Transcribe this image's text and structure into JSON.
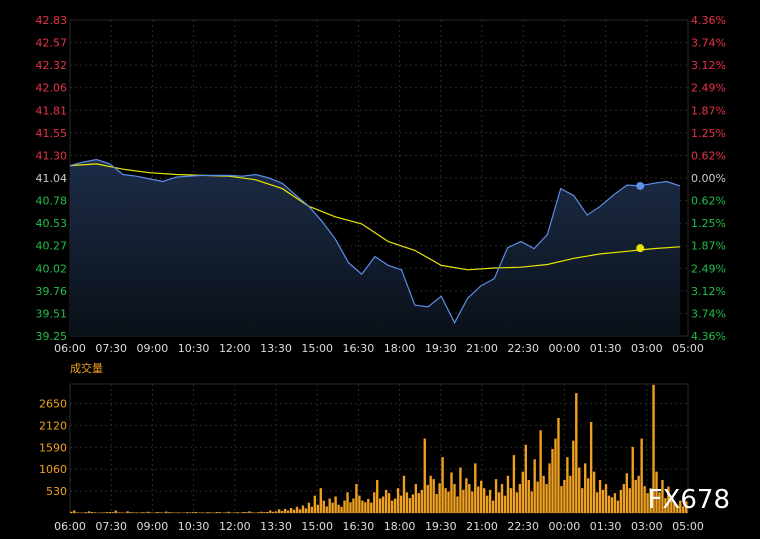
{
  "watermark": "FX678",
  "volume_label": "成交量",
  "colors": {
    "background": "#000000",
    "grid": "#2a2a2a",
    "price_line": "#5b8fe8",
    "avg_line": "#e6e600",
    "price_fill_top": "#1c2c48",
    "price_fill_bottom": "#0a1018",
    "volume": "#f0a020",
    "up_label": "#e8334a",
    "down_label": "#1fbf4a",
    "neutral_label": "#cccccc"
  },
  "chart_data": [
    {
      "type": "line",
      "name": "price",
      "x_ticks": [
        "06:00",
        "07:30",
        "09:00",
        "10:30",
        "12:00",
        "13:30",
        "15:00",
        "16:30",
        "18:00",
        "19:30",
        "21:00",
        "22:30",
        "00:00",
        "01:30",
        "03:00",
        "05:00"
      ],
      "y_left_ticks": [
        "42.83",
        "42.57",
        "42.32",
        "42.06",
        "41.81",
        "41.55",
        "41.30",
        "41.04",
        "40.78",
        "40.53",
        "40.27",
        "40.02",
        "39.76",
        "39.51",
        "39.25"
      ],
      "y_right_ticks": [
        "4.36%",
        "3.74%",
        "3.12%",
        "2.49%",
        "1.87%",
        "1.25%",
        "0.62%",
        "0.00%",
        "0.62%",
        "1.25%",
        "1.87%",
        "2.49%",
        "3.12%",
        "3.74%",
        "4.36%"
      ],
      "ylim": [
        39.25,
        42.83
      ],
      "reference_price": 41.04,
      "grid": true,
      "series": [
        {
          "name": "price",
          "x": [
            0,
            0.5,
            1,
            1.5,
            2,
            2.5,
            3,
            3.5,
            4,
            4.5,
            5,
            5.5,
            6,
            6.5,
            7,
            7.5,
            8,
            8.5,
            9,
            9.5,
            10,
            10.5,
            11,
            11.5,
            12,
            12.5,
            13,
            13.5,
            14,
            14.5,
            15,
            15.5,
            16,
            16.5,
            17,
            17.5,
            18,
            18.5,
            19,
            19.5,
            20,
            20.5,
            21,
            21.5,
            22,
            22.5,
            23
          ],
          "values": [
            41.18,
            41.22,
            41.25,
            41.2,
            41.08,
            41.06,
            41.03,
            41.0,
            41.05,
            41.06,
            41.07,
            41.07,
            41.07,
            41.06,
            41.08,
            41.04,
            40.98,
            40.85,
            40.72,
            40.55,
            40.35,
            40.08,
            39.95,
            40.15,
            40.05,
            40.0,
            39.6,
            39.58,
            39.7,
            39.4,
            39.68,
            39.82,
            39.9,
            40.25,
            40.32,
            40.24,
            40.4,
            40.92,
            40.84,
            40.62,
            40.72,
            40.85,
            40.96,
            40.95,
            40.98,
            41.0,
            40.95
          ]
        },
        {
          "name": "average",
          "x": [
            0,
            1,
            2,
            3,
            4,
            5,
            6,
            7,
            8,
            9,
            10,
            11,
            12,
            13,
            14,
            15,
            16,
            17,
            18,
            19,
            20,
            21,
            22,
            23
          ],
          "values": [
            41.18,
            41.2,
            41.14,
            41.1,
            41.08,
            41.07,
            41.06,
            41.02,
            40.92,
            40.72,
            40.6,
            40.52,
            40.32,
            40.22,
            40.05,
            40.0,
            40.02,
            40.03,
            40.06,
            40.13,
            40.18,
            40.21,
            40.24,
            40.26
          ]
        }
      ]
    },
    {
      "type": "bar",
      "name": "volume",
      "y_ticks": [
        "2650",
        "2120",
        "1590",
        "1060",
        "530"
      ],
      "tick_values": [
        2650,
        2120,
        1590,
        1060,
        530
      ],
      "ylim": [
        0,
        3120
      ],
      "grid": true,
      "values": [
        30,
        60,
        15,
        10,
        10,
        20,
        40,
        25,
        15,
        10,
        10,
        15,
        20,
        25,
        20,
        60,
        15,
        15,
        10,
        40,
        20,
        15,
        15,
        10,
        20,
        15,
        30,
        10,
        10,
        25,
        15,
        10,
        35,
        20,
        15,
        10,
        15,
        10,
        10,
        20,
        15,
        20,
        25,
        10,
        15,
        10,
        20,
        15,
        10,
        25,
        20,
        10,
        15,
        30,
        10,
        15,
        20,
        10,
        25,
        20,
        40,
        15,
        10,
        20,
        30,
        20,
        25,
        60,
        30,
        40,
        90,
        50,
        100,
        60,
        120,
        80,
        150,
        90,
        180,
        110,
        250,
        150,
        420,
        200,
        600,
        300,
        160,
        350,
        250,
        400,
        200,
        150,
        300,
        500,
        260,
        350,
        700,
        420,
        300,
        260,
        340,
        250,
        500,
        800,
        350,
        400,
        560,
        480,
        300,
        350,
        600,
        420,
        900,
        500,
        360,
        450,
        700,
        480,
        560,
        1800,
        680,
        900,
        820,
        460,
        720,
        1350,
        600,
        520,
        980,
        700,
        400,
        1100,
        560,
        840,
        700,
        520,
        1200,
        640,
        780,
        600,
        420,
        560,
        300,
        820,
        500,
        700,
        420,
        900,
        600,
        1400,
        500,
        700,
        1000,
        1650,
        800,
        520,
        1300,
        760,
        2000,
        900,
        700,
        1200,
        1550,
        1800,
        2300,
        650,
        800,
        1350,
        900,
        1750,
        2900,
        1100,
        600,
        1200,
        840,
        2200,
        1000,
        500,
        800,
        560,
        700,
        420,
        380,
        480,
        300,
        560,
        700,
        960,
        600,
        1600,
        800,
        900,
        1800,
        650,
        480,
        600,
        3100,
        1000,
        500,
        800,
        360,
        640,
        300,
        240,
        200,
        300,
        160,
        280
      ]
    }
  ]
}
